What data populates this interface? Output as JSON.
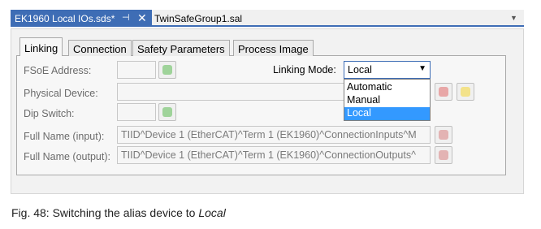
{
  "doc_tabs": {
    "active_label": "EK1960 Local IOs.sds*",
    "pin_glyph": "⊣",
    "close_glyph": "✕",
    "second_label": "TwinSafeGroup1.sal",
    "overflow_glyph": "▼"
  },
  "tabs": [
    "Linking",
    "Connection",
    "Safety Parameters",
    "Process Image"
  ],
  "form": {
    "fsoe_label": "FSoE Address:",
    "linking_mode_label": "Linking Mode:",
    "linking_mode_value": "Local",
    "physical_device_label": "Physical Device:",
    "dip_switch_label": "Dip Switch:",
    "full_name_input_label": "Full Name (input):",
    "full_name_input_value": "TIID^Device 1 (EtherCAT)^Term 1 (EK1960)^ConnectionInputs^M",
    "full_name_output_label": "Full Name (output):",
    "full_name_output_value": "TIID^Device 1 (EtherCAT)^Term 1 (EK1960)^ConnectionOutputs^"
  },
  "dropdown_options": [
    "Automatic",
    "Manual",
    "Local"
  ],
  "dropdown_selected": "Local",
  "caption": {
    "prefix": "Fig. 48: Switching the alias device to ",
    "emphasis": "Local"
  }
}
